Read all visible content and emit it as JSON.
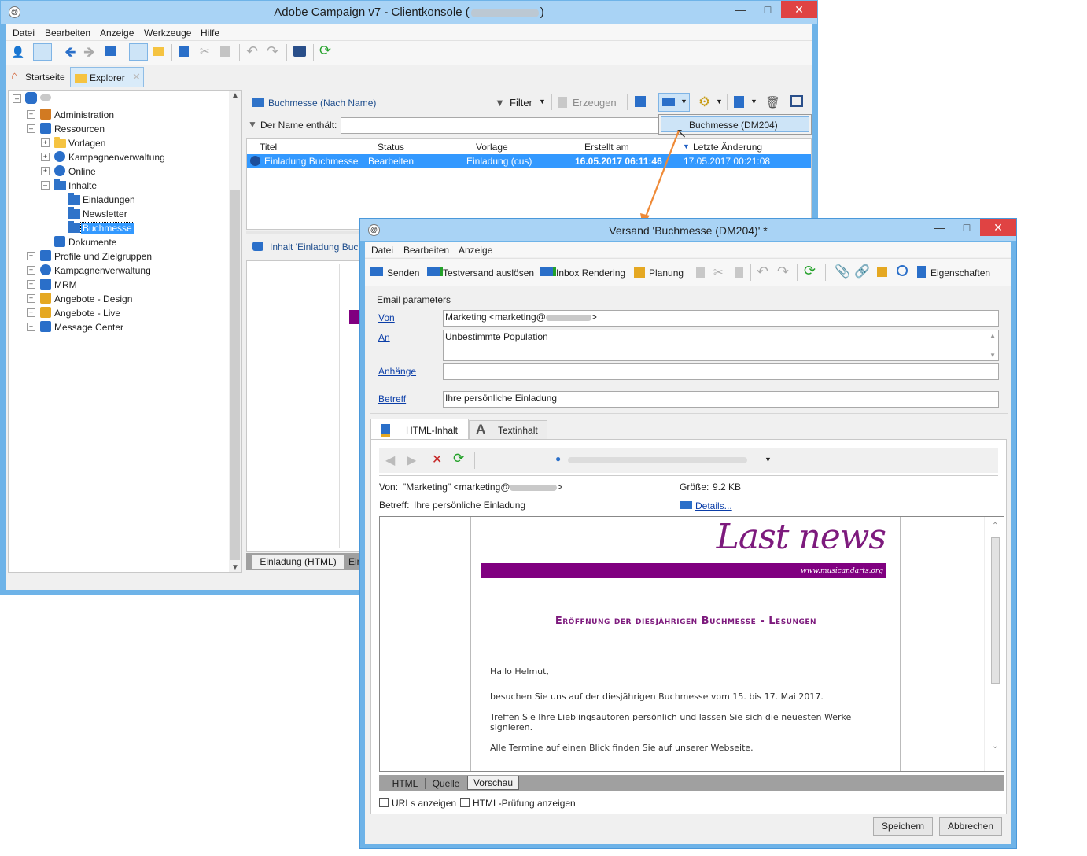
{
  "main_window": {
    "title": "Adobe Campaign v7 - Clientkonsole (",
    "title_suffix": ")",
    "menu": [
      "Datei",
      "Bearbeiten",
      "Anzeige",
      "Werkzeuge",
      "Hilfe"
    ],
    "tabs": [
      {
        "label": "Startseite",
        "icon": "home-icon"
      },
      {
        "label": "Explorer",
        "icon": "folder-icon"
      }
    ],
    "tree": [
      {
        "label": "Administration",
        "icon": "wrench-icon",
        "level": 1
      },
      {
        "label": "Ressourcen",
        "icon": "resources-icon",
        "level": 1
      },
      {
        "label": "Vorlagen",
        "icon": "folder-icon",
        "level": 2
      },
      {
        "label": "Kampagnenverwaltung",
        "icon": "gear-icon",
        "level": 2
      },
      {
        "label": "Online",
        "icon": "globe-icon",
        "level": 2
      },
      {
        "label": "Inhalte",
        "icon": "folder-blue-icon",
        "level": 2
      },
      {
        "label": "Einladungen",
        "icon": "folder-blue-icon",
        "level": 3
      },
      {
        "label": "Newsletter",
        "icon": "folder-blue-icon",
        "level": 3
      },
      {
        "label": "Buchmesse",
        "icon": "folder-blue-icon",
        "level": 3
      },
      {
        "label": "Dokumente",
        "icon": "documents-icon",
        "level": 2
      },
      {
        "label": "Profile und Zielgruppen",
        "icon": "profiles-icon",
        "level": 1
      },
      {
        "label": "Kampagnenverwaltung",
        "icon": "gear-icon",
        "level": 1
      },
      {
        "label": "MRM",
        "icon": "mrm-icon",
        "level": 1
      },
      {
        "label": "Angebote - Design",
        "icon": "offer-icon",
        "level": 1
      },
      {
        "label": "Angebote - Live",
        "icon": "offer-icon",
        "level": 1
      },
      {
        "label": "Message Center",
        "icon": "monitor-icon",
        "level": 1
      }
    ],
    "list_panel": {
      "title": "Buchmesse (Nach Name)",
      "filter_label": "Filter",
      "create_label": "Erzeugen",
      "name_filter_label": "Der Name enthält:",
      "dropdown_item": "Buchmesse (DM204)",
      "columns": [
        "Titel",
        "Status",
        "Vorlage",
        "Erstellt am",
        "Letzte Änderung"
      ],
      "rows": [
        {
          "title": "Einladung Buchmesse",
          "status": "Bearbeiten",
          "template": "Einladung (cus)",
          "created": "16.05.2017 06:11:46",
          "modified": "17.05.2017 00:21:08"
        }
      ]
    },
    "detail_panel": {
      "title": "Inhalt 'Einladung Buch",
      "bottom_tab_1": "Einladung (HTML)",
      "bottom_tab_2": "Ein"
    }
  },
  "delivery_window": {
    "title": "Versand 'Buchmesse (DM204)' *",
    "menu": [
      "Datei",
      "Bearbeiten",
      "Anzeige"
    ],
    "toolbar": {
      "send": "Senden",
      "proof": "Testversand auslösen",
      "inbox": "Inbox Rendering",
      "schedule": "Planung",
      "properties": "Eigenschaften"
    },
    "email_params": {
      "group_label": "Email parameters",
      "from_label": "Von",
      "from_value": "Marketing <marketing@",
      "from_value_end": ">",
      "to_label": "An",
      "to_value": "Unbestimmte Population",
      "attachments_label": "Anhänge",
      "attachments_value": "",
      "subject_label": "Betreff",
      "subject_value": "Ihre persönliche Einladung"
    },
    "content_tabs": [
      "HTML-Inhalt",
      "Textinhalt"
    ],
    "preview": {
      "from_label": "Von:",
      "from_value": "\"Marketing\" <marketing@",
      "from_value_end": ">",
      "size_label": "Größe:",
      "size_value": "9.2 KB",
      "subject_label": "Betreff:",
      "subject_value": "Ihre persönliche Einladung",
      "details_link": "Details..."
    },
    "email_body": {
      "logo_text": "Last news",
      "logo_url": "www.musicandarts.org",
      "heading": "Eröffnung der diesjährigen Buchmesse - Lesungen",
      "greeting": "Hallo Helmut,",
      "para1": "besuchen Sie uns auf der diesjährigen Buchmesse vom 15. bis 17. Mai 2017.",
      "para2": "Treffen Sie Ihre Lieblingsautoren persönlich und lassen Sie sich die neuesten Werke signieren.",
      "para3": "Alle Termine auf einen Blick finden Sie auf unserer Webseite."
    },
    "view_tabs": [
      "HTML",
      "Quelle",
      "Vorschau"
    ],
    "checkboxes": [
      "URLs anzeigen",
      "HTML-Prüfung anzeigen"
    ],
    "buttons": {
      "save": "Speichern",
      "cancel": "Abbrechen"
    }
  },
  "colors": {
    "window_frame": "#6eb3e8",
    "selection": "#3399ff",
    "accent_purple": "#800080",
    "link_blue": "#0b3ea8"
  }
}
